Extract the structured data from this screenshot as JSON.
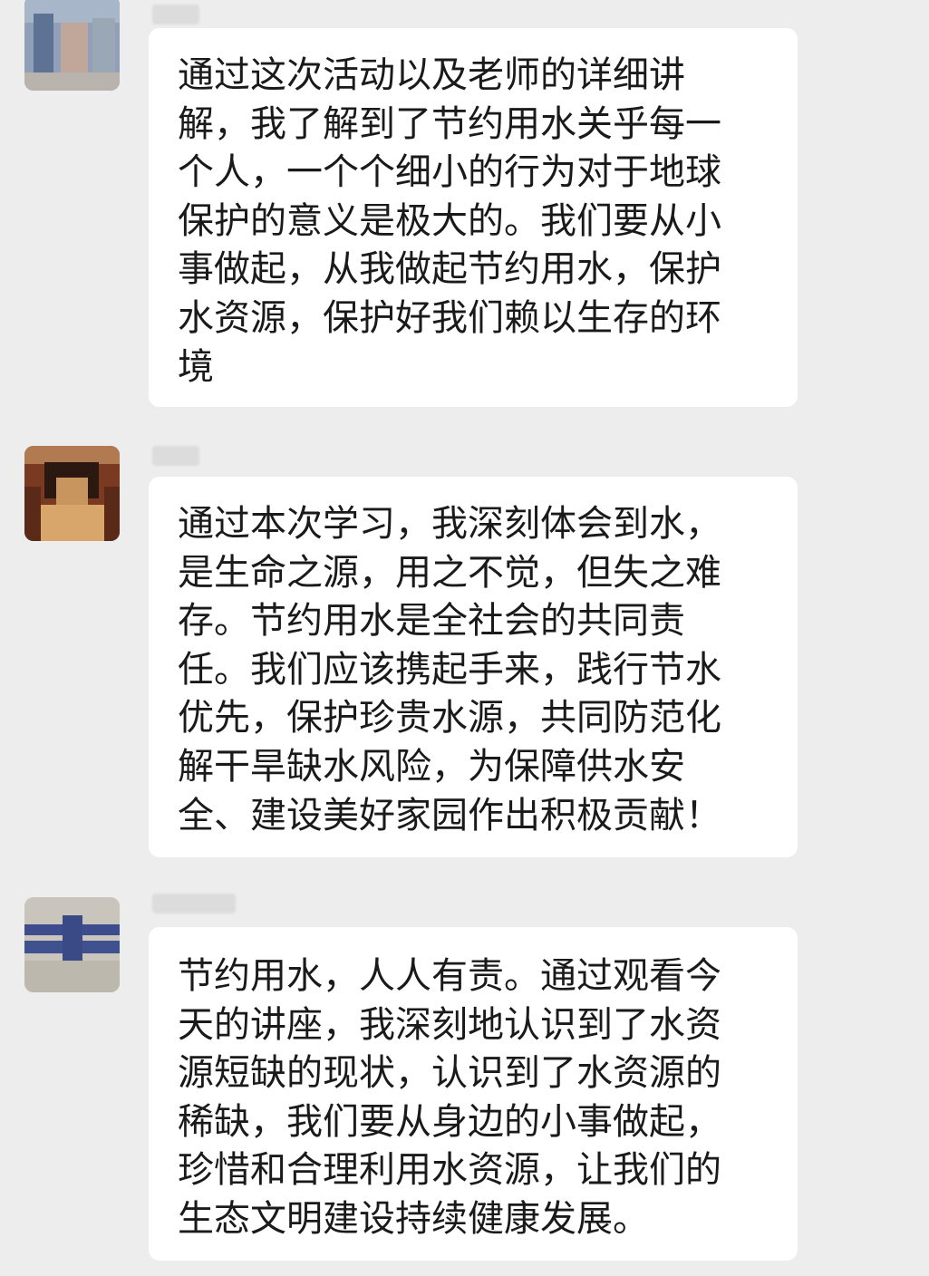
{
  "chat": {
    "messages": [
      {
        "sender": "",
        "text": "通过这次活动以及老师的详细讲\n解，我了解到了节约用水关乎每一\n个人，一个个细小的行为对于地球\n保护的意义是极大的。我们要从小\n事做起，从我做起节约用水，保护\n水资源，保护好我们赖以生存的环\n境"
      },
      {
        "sender": "",
        "text": "通过本次学习，我深刻体会到水，\n是生命之源，用之不觉，但失之难\n存。节约用水是全社会的共同责\n任。我们应该携起手来，践行节水\n优先，保护珍贵水源，共同防范化\n解干旱缺水风险，为保障供水安\n全、建设美好家园作出积极贡献！"
      },
      {
        "sender": "",
        "text": "节约用水，人人有责。通过观看今\n天的讲座，我深刻地认识到了水资\n源短缺的现状，认识到了水资源的\n稀缺，我们要从身边的小事做起，\n珍惜和合理利用水资源，让我们的\n生态文明建设持续健康发展。"
      }
    ]
  }
}
